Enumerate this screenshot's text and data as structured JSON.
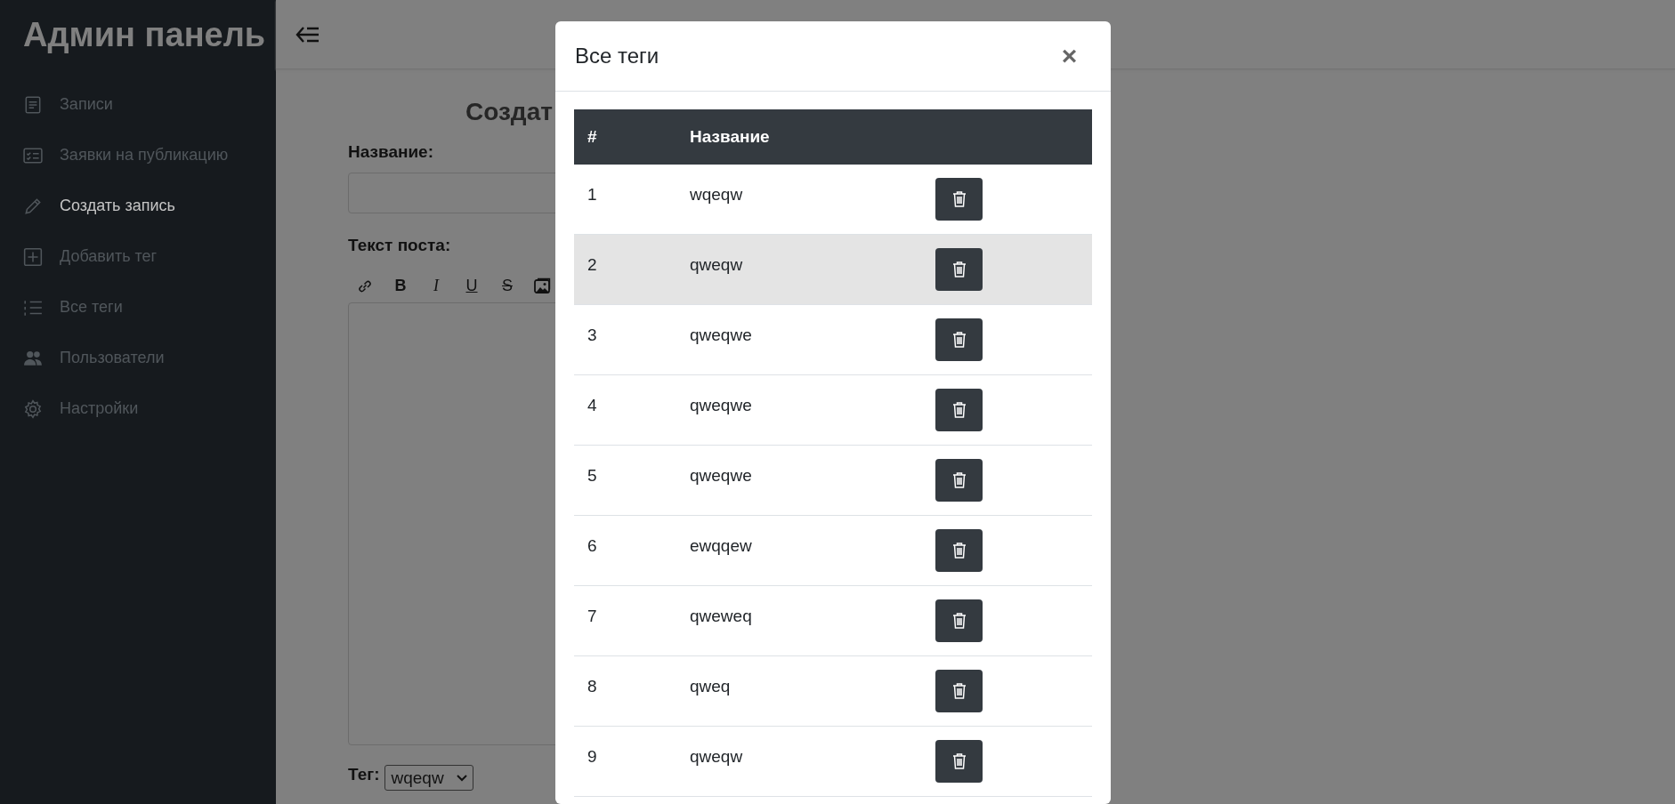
{
  "sidebar": {
    "title": "Админ панель",
    "items": [
      {
        "label": "Записи",
        "selected": false
      },
      {
        "label": "Заявки на публикацию",
        "selected": false
      },
      {
        "label": "Создать запись",
        "selected": true
      },
      {
        "label": "Добавить тег",
        "selected": false
      },
      {
        "label": "Все теги",
        "selected": false
      },
      {
        "label": "Пользователи",
        "selected": false
      },
      {
        "label": "Настройки",
        "selected": false
      }
    ]
  },
  "form": {
    "heading": "Создат",
    "title_label": "Название:",
    "text_label": "Текст поста:",
    "toolbar": [
      {
        "kind": "link"
      },
      {
        "kind": "bold",
        "label": "B"
      },
      {
        "kind": "italic",
        "label": "I"
      },
      {
        "kind": "underline",
        "label": "U"
      },
      {
        "kind": "strike",
        "label": "S"
      },
      {
        "kind": "image"
      }
    ],
    "tag_label": "Тег:",
    "tag_value": "wqeqw"
  },
  "modal": {
    "title": "Все теги",
    "close": "×",
    "columns": [
      "#",
      "Название"
    ],
    "rows": [
      {
        "number": "1",
        "name": "wqeqw",
        "selected": false
      },
      {
        "number": "2",
        "name": "qweqw",
        "selected": true
      },
      {
        "number": "3",
        "name": "qweqwe",
        "selected": false
      },
      {
        "number": "4",
        "name": "qweqwe",
        "selected": false
      },
      {
        "number": "5",
        "name": "qweqwe",
        "selected": false
      },
      {
        "number": "6",
        "name": "ewqqew",
        "selected": false
      },
      {
        "number": "7",
        "name": "qweweq",
        "selected": false
      },
      {
        "number": "8",
        "name": "qweq",
        "selected": false
      },
      {
        "number": "9",
        "name": "qweqw",
        "selected": false
      }
    ]
  }
}
